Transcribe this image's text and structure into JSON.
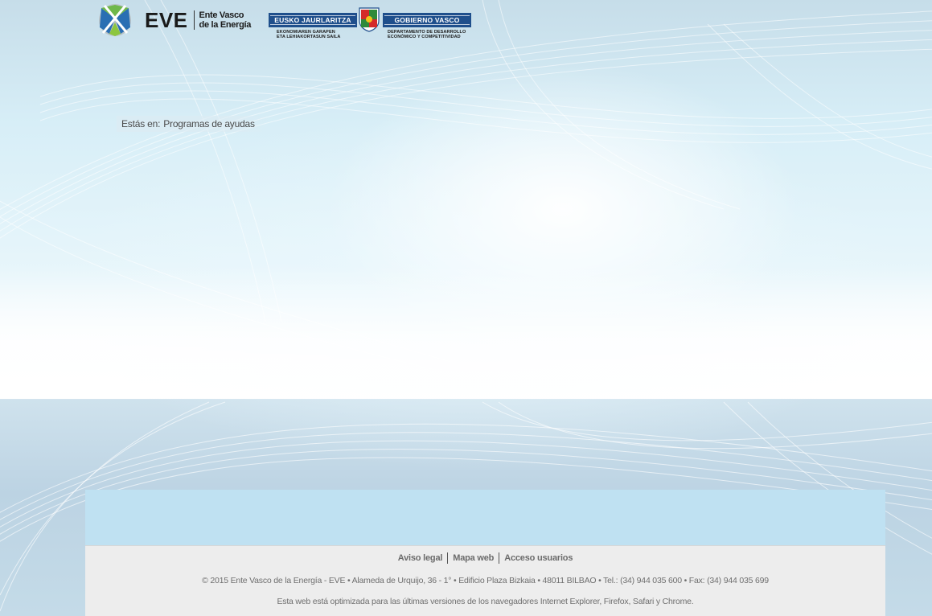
{
  "header": {
    "eve_logo_text": "EVE",
    "eve_subtitle_line1": "Ente Vasco",
    "eve_subtitle_line2": "de la Energía",
    "gv_left_bar": "EUSKO JAURLARITZA",
    "gv_right_bar": "GOBIERNO VASCO",
    "gv_left_small_line1": "EKONOMIAREN GARAPEN",
    "gv_left_small_line2": "ETA LEHIAKORTASUN SAILA",
    "gv_right_small_line1": "DEPARTAMENTO DE DESARROLLO",
    "gv_right_small_line2": "ECONÓMICO Y COMPETITIVIDAD"
  },
  "breadcrumb": {
    "prefix": "Estás en:",
    "current": "Programas de ayudas"
  },
  "footer": {
    "links": [
      "Aviso legal",
      "Mapa web",
      "Acceso usuarios"
    ],
    "address": "© 2015 Ente Vasco de la Energía - EVE • Alameda de Urquijo, 36 - 1° • Edificio Plaza Bizkaia • 48011 BILBAO • Tel.: (34) 944 035 600 • Fax: (34) 944 035 699",
    "note": "Esta web está optimizada para las últimas versiones de los navegadores Internet Explorer, Firefox, Safari y Chrome."
  },
  "colors": {
    "gv_blue": "#1f4f8c",
    "footer_blue": "#bfe1f2",
    "footer_gray": "#ededed"
  }
}
